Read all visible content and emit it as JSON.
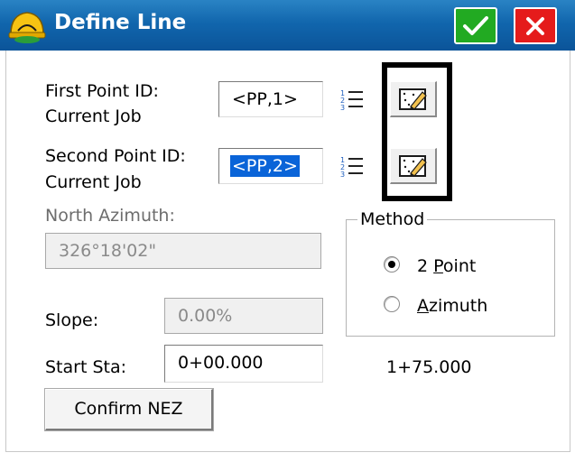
{
  "window": {
    "title": "Define Line",
    "ok_icon": "checkmark-icon",
    "close_icon": "close-x-icon"
  },
  "first_point": {
    "label_line1": "First Point ID:",
    "label_line2": "Current Job",
    "value": "<PP,1>"
  },
  "second_point": {
    "label_line1": "Second Point ID:",
    "label_line2": "Current Job",
    "value": "<PP,2>"
  },
  "azimuth": {
    "label": "North Azimuth:",
    "value": "326°18'02\""
  },
  "method": {
    "legend": "Method",
    "options": [
      {
        "label_prefix": "2 ",
        "label_accel": "P",
        "label_suffix": "oint",
        "selected": true
      },
      {
        "label_prefix": "",
        "label_accel": "A",
        "label_suffix": "zimuth",
        "selected": false
      }
    ]
  },
  "slope": {
    "label": "Slope:",
    "value": "0.00%"
  },
  "start_sta": {
    "label": "Start Sta:",
    "value": "0+00.000"
  },
  "end_sta": {
    "value": "1+75.000"
  },
  "confirm_button": {
    "label": "Confirm NEZ"
  },
  "colors": {
    "titlebar": "#1166ad",
    "ok_button": "#22aa22",
    "close_button": "#e51b1b",
    "selection": "#0a64d8"
  }
}
